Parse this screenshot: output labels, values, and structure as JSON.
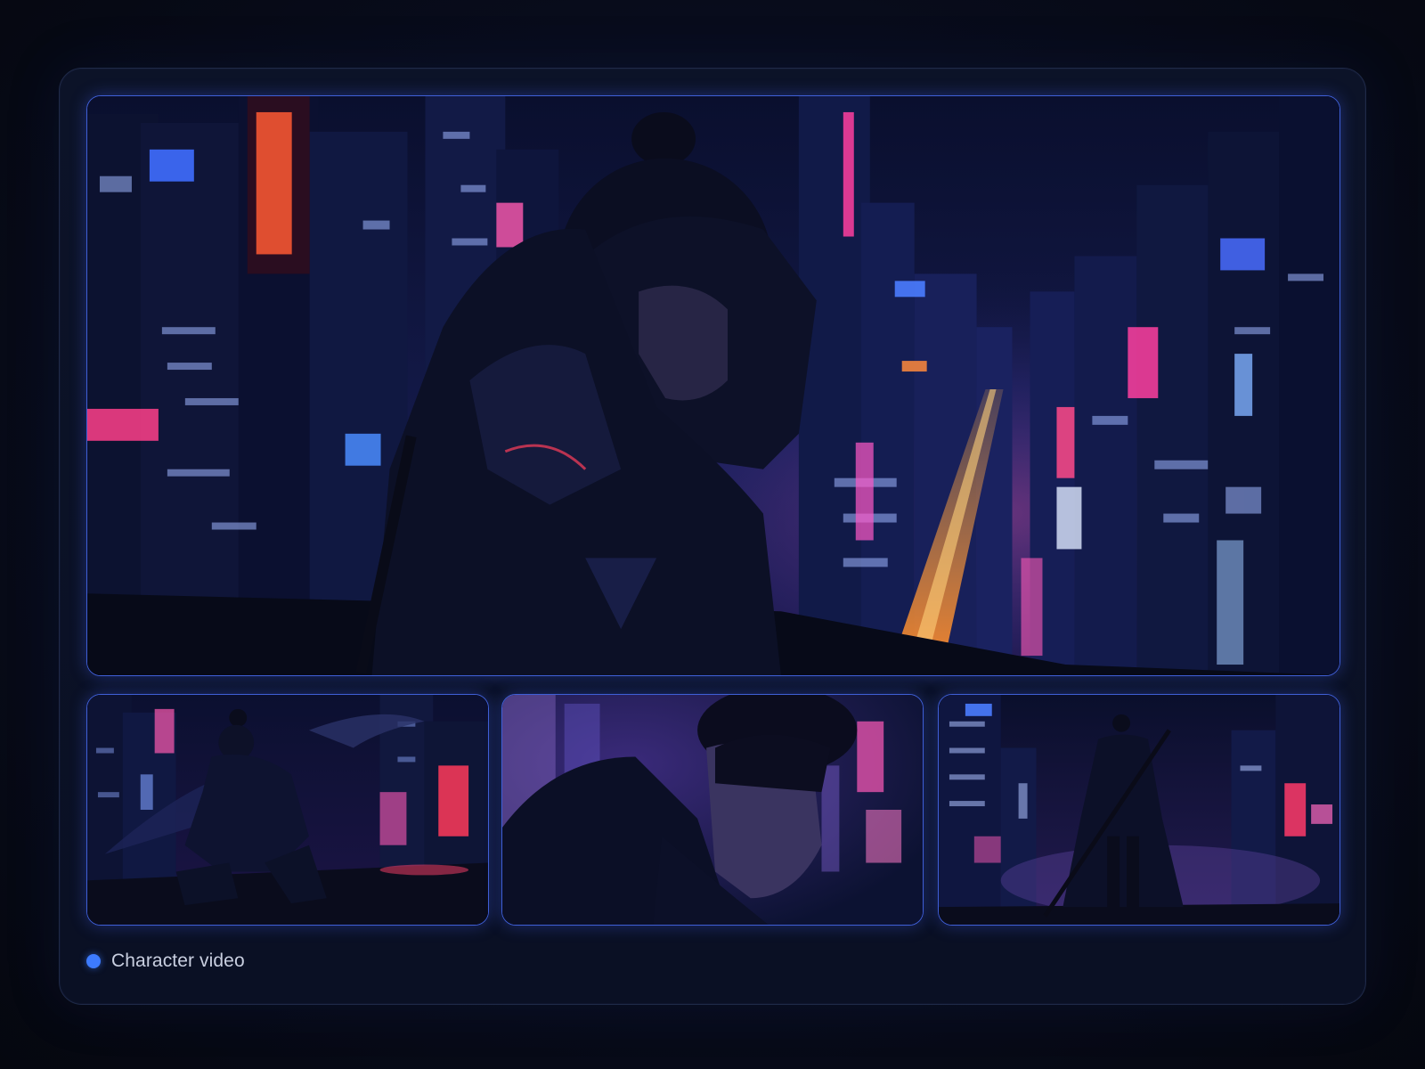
{
  "caption": {
    "label": "Character video",
    "dot_color": "#3d7bff"
  },
  "media": {
    "hero": {
      "icon": "character-city-image"
    },
    "thumbnails": [
      {
        "icon": "character-crouching-image"
      },
      {
        "icon": "character-closeup-image"
      },
      {
        "icon": "character-back-view-image"
      }
    ]
  },
  "colors": {
    "frame_border": "#3f5fd6",
    "panel_bg": "#0c1328",
    "page_bg": "#070b18",
    "neon_pink": "#ff3fa0",
    "neon_orange": "#ff7a3c",
    "neon_blue": "#4a8cff"
  }
}
